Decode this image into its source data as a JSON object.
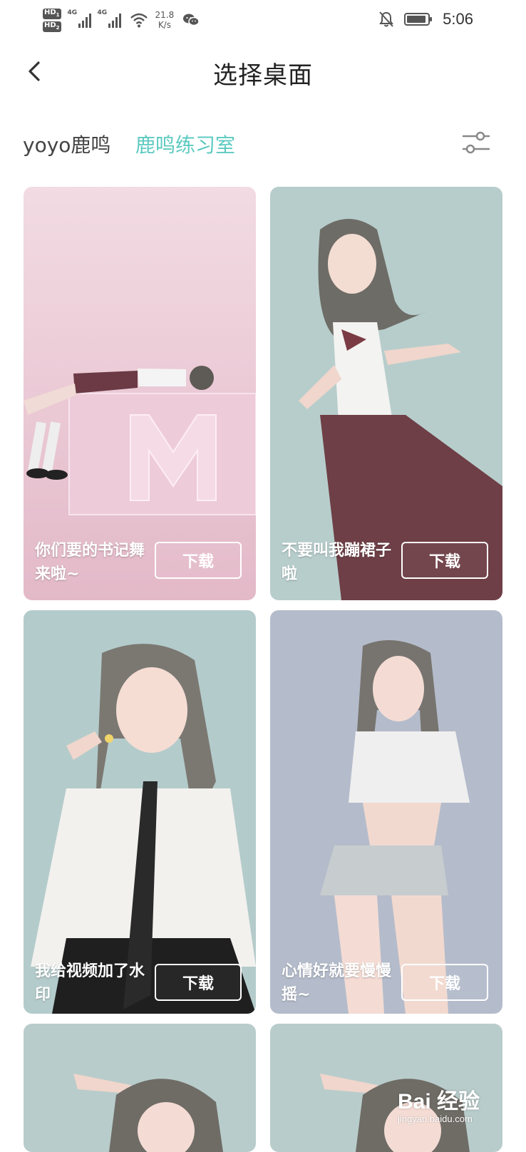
{
  "status_bar": {
    "hd1": "HD",
    "hd1_sub": "1",
    "hd2": "HD",
    "hd2_sub": "2",
    "sim1_label": "4G",
    "sim2_label": "4G",
    "speed_value": "21.8",
    "speed_unit": "K/s",
    "time": "5:06",
    "icons": [
      "signal-icon",
      "wifi-icon",
      "wechat-icon",
      "mute-bell-icon",
      "battery-icon"
    ]
  },
  "header": {
    "back_icon": "chevron-left-icon",
    "title": "选择桌面"
  },
  "tabs": {
    "items": [
      {
        "label": "yoyo鹿鸣",
        "active": false
      },
      {
        "label": "鹿鸣练习室",
        "active": true
      }
    ],
    "active_color": "#5ccac0",
    "filter_icon": "sliders-icon"
  },
  "cards": [
    {
      "caption": "你们要的书记舞来啦~",
      "button": "下载",
      "background": "#f0d4dd"
    },
    {
      "caption": "不要叫我蹦裙子啦",
      "button": "下载",
      "background": "#b7cdcc"
    },
    {
      "caption": "我给视频加了水印",
      "button": "下载",
      "background": "#b4cbcb"
    },
    {
      "caption": "心情好就要慢慢摇~",
      "button": "下载",
      "background": "#b4bccb"
    },
    {
      "caption": "",
      "button": "",
      "background": "#b8cccb"
    },
    {
      "caption": "",
      "button": "",
      "background": "#b8cccb"
    }
  ],
  "watermark": {
    "brand": "Bai 经验",
    "url": "jingyan.baidu.com"
  }
}
